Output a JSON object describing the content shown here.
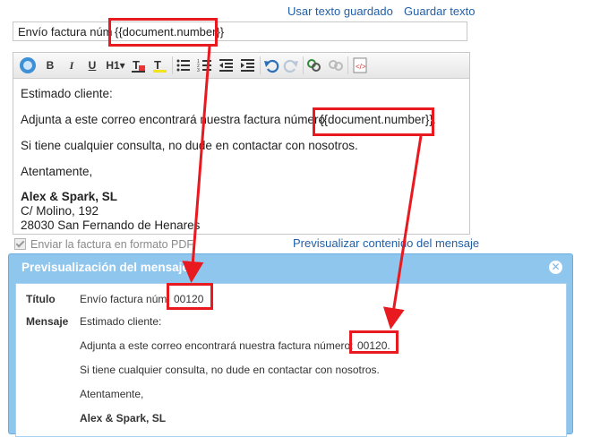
{
  "header": {
    "saved_text_link": "Usar texto guardado",
    "save_text_link": "Guardar texto"
  },
  "subject": {
    "prefix": "Envío factura núm",
    "placeholder": "{{document.number}}"
  },
  "toolbar": {
    "bold": "B",
    "italic": "I",
    "underline": "U",
    "heading": "H1▾"
  },
  "editor": {
    "greeting": "Estimado cliente:",
    "line1_before": "Adjunta a este correo encontrará nuestra factura número",
    "line1_placeholder": "{{document.number}}",
    "line1_after": ".",
    "line2": "Si tiene cualquier consulta, no dude en contactar con nosotros.",
    "closing": "Atentamente,",
    "company": "Alex & Spark, SL",
    "address1": "C/ Molino, 192",
    "address2": "28030 San Fernando de Henares"
  },
  "pdf_option": "Enviar la factura en formato PDF",
  "preview_link": "Previsualizar contenido del mensaje",
  "dialog": {
    "title": "Previsualización del mensaje",
    "close": "✕",
    "title_label": "Título",
    "title_prefix": "Envío factura núm.",
    "title_number": "00120",
    "message_label": "Mensaje",
    "msg_greeting": "Estimado cliente:",
    "msg_line1_before": "Adjunta a este correo encontrará nuestra factura número:",
    "msg_line1_number": "00120.",
    "msg_line2": "Si tiene cualquier consulta, no dude en contactar con nosotros.",
    "msg_closing": "Atentamente,",
    "msg_company": "Alex & Spark, SL"
  },
  "colors": {
    "highlight": "#e8191f",
    "dialog": "#8fc6ee",
    "link": "#1f5fa8"
  }
}
